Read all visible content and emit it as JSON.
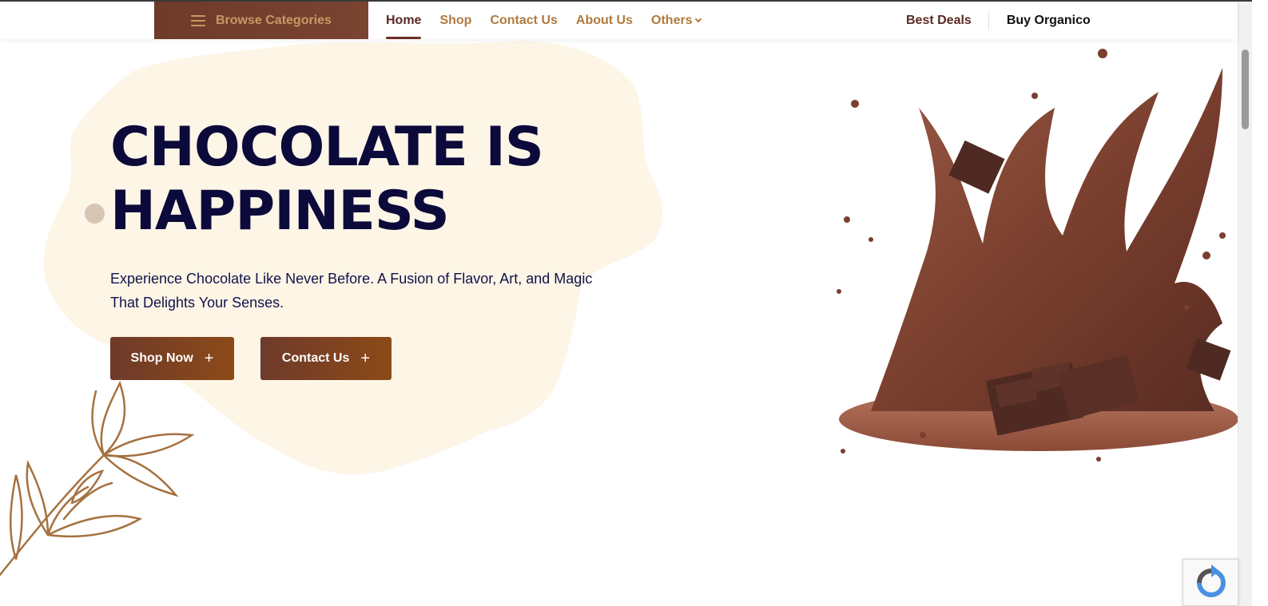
{
  "header": {
    "browse_label": "Browse Categories",
    "nav": [
      {
        "label": "Home",
        "active": true
      },
      {
        "label": "Shop",
        "active": false
      },
      {
        "label": "Contact Us",
        "active": false
      },
      {
        "label": "About Us",
        "active": false
      },
      {
        "label": "Others",
        "active": false,
        "has_dropdown": true
      }
    ],
    "best_deals": "Best Deals",
    "buy": "Buy Organico"
  },
  "hero": {
    "title_line1": "CHOCOLATE IS",
    "title_line2": "HAPPINESS",
    "subtitle_line1": "Experience Chocolate Like Never Before. A Fusion of Flavor, Art, and Magic",
    "subtitle_line2": "That Delights Your Senses.",
    "shop_button": "Shop Now",
    "contact_button": "Contact Us",
    "button_icon": "+"
  },
  "icons": {
    "menu": "hamburger-icon",
    "dropdown": "chevron-down-icon",
    "plus": "plus-icon",
    "captcha": "recaptcha-icon"
  },
  "colors": {
    "brand_brown": "#6e3a2a",
    "accent_gold": "#b07a3e",
    "heading_navy": "#0b0a3a",
    "blob_cream": "#fdf5e6"
  }
}
